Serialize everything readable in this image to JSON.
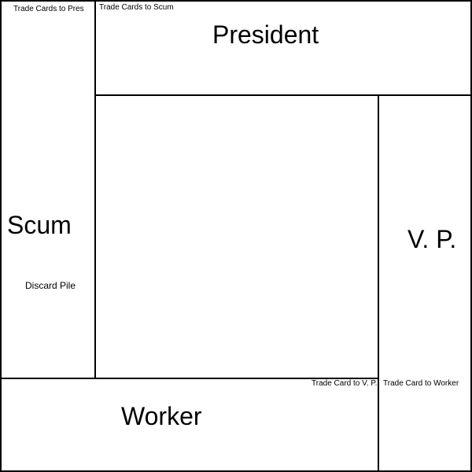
{
  "players": {
    "president": "President",
    "scum": "Scum",
    "vp": "V. P.",
    "worker": "Worker"
  },
  "trade": {
    "to_pres": "Trade Cards to Pres",
    "to_scum": "Trade Cards to Scum",
    "to_vp": "Trade Card to V. P.",
    "to_worker": "Trade Card to Worker"
  },
  "piles": {
    "discard": "Discard Pile"
  },
  "colors": {
    "background": "#ffffff",
    "lines": "#000000"
  }
}
